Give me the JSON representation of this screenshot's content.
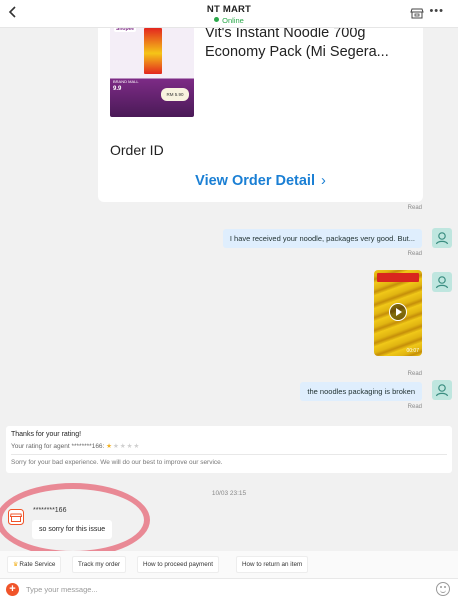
{
  "header": {
    "back_icon": "chevron-left-icon",
    "title": "NT MART",
    "status": "Online",
    "store_icon": "store-icon",
    "more_icon": "more-icon"
  },
  "order_card": {
    "product_name": "Vit's Instant Noodle 700g Economy Pack (Mi Segera...",
    "image": {
      "brand_tag": "Shopee",
      "sale_label": "9.9",
      "sale_sub": "BRAND MALL",
      "price_badge": "RM 5.90"
    },
    "order_id_label": "Order ID",
    "view_detail_label": "View Order Detail",
    "chevron": "›"
  },
  "messages": {
    "read_1": "Read",
    "msg_1": "I have received your noodle, packages very good. But...",
    "read_2": "Read",
    "video_duration": "00:07",
    "read_3": "Read",
    "msg_2": "the noodles packaging is broken",
    "read_4": "Read"
  },
  "rating": {
    "title": "Thanks for your rating!",
    "line_prefix": "Your rating for agent ********166:",
    "stars_filled": 1,
    "stars_total": 5,
    "apology": "Sorry for your bad experience. We will do our best to improve our service."
  },
  "timestamp": "10/03 23:15",
  "agent": {
    "name": "********166",
    "message": "so sorry for this issue"
  },
  "quick_replies": [
    "Rate Service",
    "Track my order",
    "How to proceed payment",
    "How to return an item"
  ],
  "input": {
    "placeholder": "Type your message...",
    "value": ""
  },
  "colors": {
    "accent_blue": "#1a7fd4",
    "online_green": "#2aa84a",
    "out_bubble": "#dfeefd",
    "user_avatar": "#bfe6df",
    "highlight": "#e8808d",
    "add_button": "#f0542a"
  }
}
